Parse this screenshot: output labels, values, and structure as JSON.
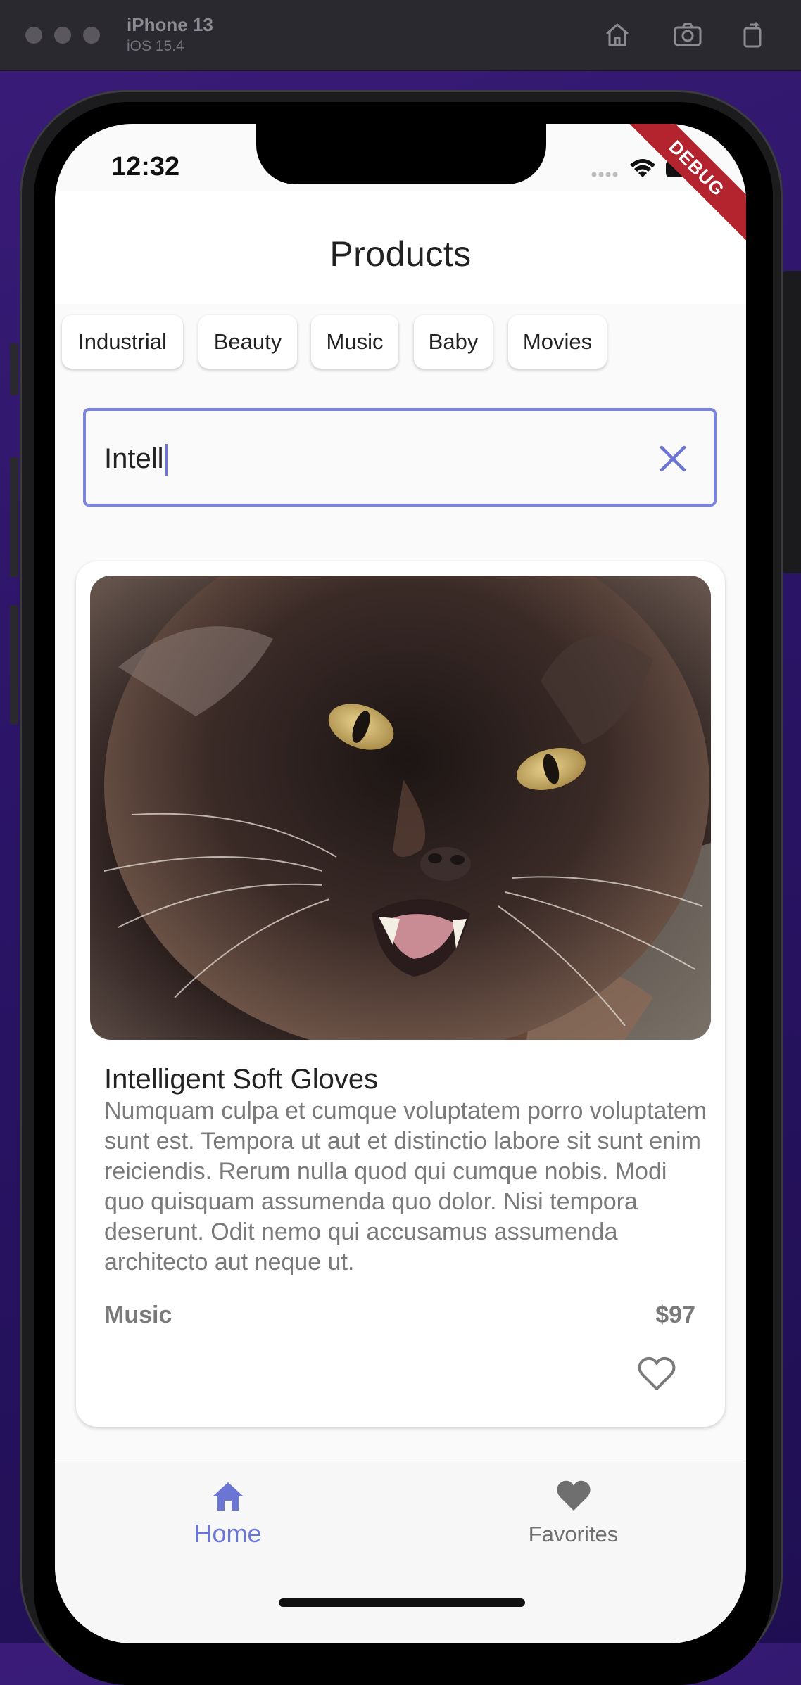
{
  "simulator": {
    "device": "iPhone 13",
    "os": "iOS 15.4",
    "tools": [
      "home-icon",
      "screenshot-icon",
      "rotate-icon"
    ]
  },
  "status_bar": {
    "time": "12:32",
    "debug_label": "DEBUG"
  },
  "appbar": {
    "title": "Products"
  },
  "categories": [
    "Industrial",
    "Beauty",
    "Music",
    "Baby",
    "Movies"
  ],
  "search": {
    "value": "Intell"
  },
  "product": {
    "image": "cat-photo",
    "name": "Intelligent Soft Gloves",
    "description": "Numquam culpa et cumque voluptatem porro voluptatem sunt est. Tempora ut aut et distinctio labore sit sunt enim reiciendis. Rerum nulla quod qui cumque nobis. Modi quo quisquam assumenda quo dolor. Nisi tempora deserunt. Odit nemo qui accusamus assumenda architecto aut neque ut.",
    "category": "Music",
    "price": "$97",
    "favorite": false
  },
  "bottom_nav": {
    "home_label": "Home",
    "favorites_label": "Favorites",
    "active": "home"
  },
  "colors": {
    "accent": "#6b75d4",
    "inactive": "#7a7a7a"
  }
}
